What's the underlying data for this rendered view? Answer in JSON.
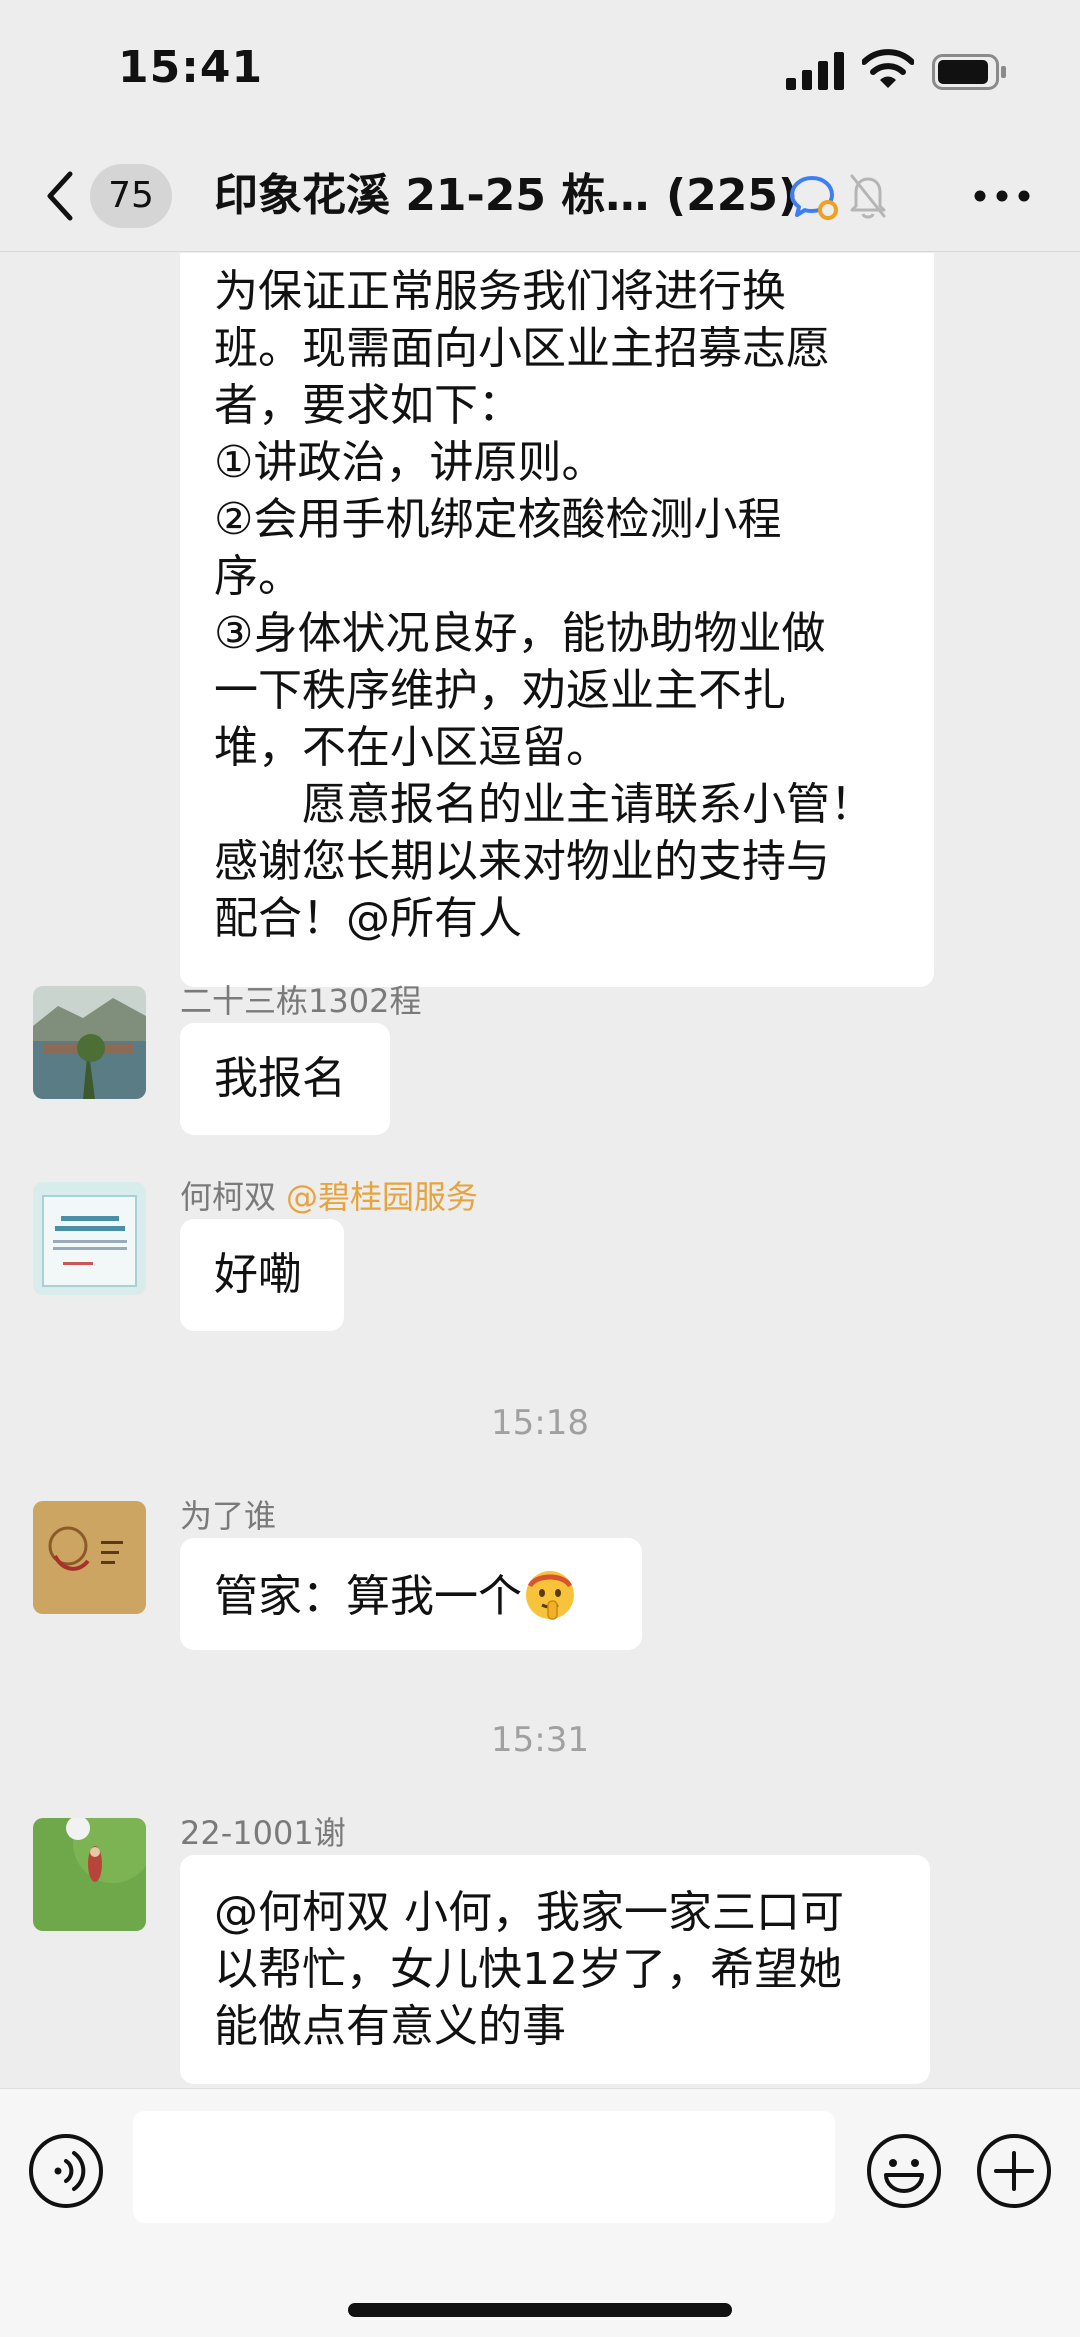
{
  "status_bar": {
    "time": "15:41"
  },
  "nav": {
    "unread_count": "75",
    "title": "印象花溪 21-25 栋…",
    "member_count": "(225)"
  },
  "messages": {
    "first": {
      "text": "为保证正常服务我们将进行换\n班。现需面向小区业主招募志愿\n者，要求如下：\n①讲政治，讲原则。\n②会用手机绑定核酸检测小程\n序。\n③身体状况良好，能协助物业做\n一下秩序维护，劝返业主不扎\n堆，不在小区逗留。\n　　愿意报名的业主请联系小管！\n感谢您长期以来对物业的支持与\n配合！@所有人"
    },
    "msg1": {
      "sender": "二十三栋1302程",
      "text": "我报名"
    },
    "msg2": {
      "sender": "何柯双",
      "sender_tag": "@碧桂园服务",
      "text": "好嘞"
    },
    "time1": "15:18",
    "msg3": {
      "sender": "为了谁",
      "text": "管家：算我一个"
    },
    "time2": "15:31",
    "msg4": {
      "sender": "22-1001谢",
      "text": "@何柯双 小何，我家一家三口可\n以帮忙，女儿快12岁了，希望她\n能做点有意义的事"
    }
  },
  "input": {
    "placeholder": ""
  },
  "icons": {
    "back": "chevron-left-icon",
    "enterprise": "enterprise-chat-icon",
    "mute": "bell-off-icon",
    "more": "more-dots-icon",
    "voice": "voice-icon",
    "emoji": "emoji-icon",
    "plus": "plus-icon"
  },
  "colors": {
    "background": "#ededed",
    "bubble": "#ffffff",
    "sender_tag": "#e8a33c",
    "timestamp": "#a0a0a0"
  }
}
